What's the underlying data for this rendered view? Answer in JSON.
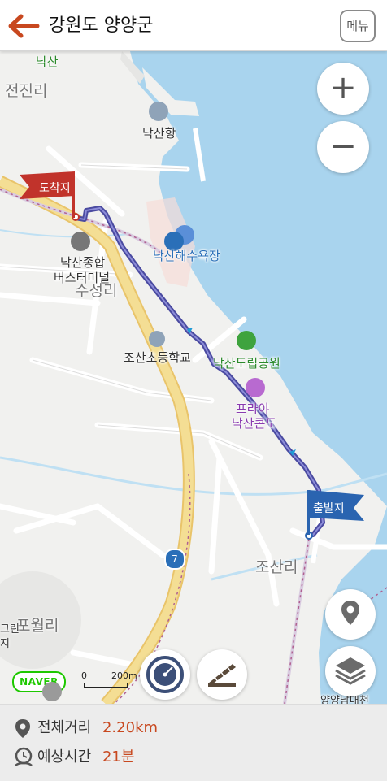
{
  "header": {
    "title": "강원도 양양군",
    "menu_label": "메뉴"
  },
  "map": {
    "labels": {
      "naksan_top": "낙산",
      "jeonjin": "전진리",
      "naksan_port": "낙산항",
      "naksan_beach": "낙산해수욕장",
      "bus_terminal_1": "낙산종합",
      "bus_terminal_2": "버스터미널",
      "suseong": "수성리",
      "josan_school": "조산초등학교",
      "naksan_park": "낙산도립공원",
      "condo_1": "프라야",
      "condo_2": "낙산콘도",
      "josan": "조산리",
      "pogwol": "포월리",
      "green": "그린",
      "ji": "지",
      "namdaecheon": "양양남대천",
      "route_number": "7"
    },
    "markers": {
      "arrival": "도착지",
      "departure": "출발지"
    },
    "controls": {
      "zoom_in": "+",
      "zoom_out": "−"
    },
    "logo": "NAVER",
    "scale": {
      "zero": "0",
      "distance": "200m"
    },
    "colors": {
      "sea": "#a9d4ee",
      "route": "#4a4aa0",
      "arrival_flag": "#c1332b",
      "departure_flag": "#2a64b0",
      "road_yellow": "#f4de94"
    }
  },
  "footer": {
    "distance_label": "전체거리",
    "distance_value": "2.20km",
    "time_label": "예상시간",
    "time_value": "21분"
  }
}
